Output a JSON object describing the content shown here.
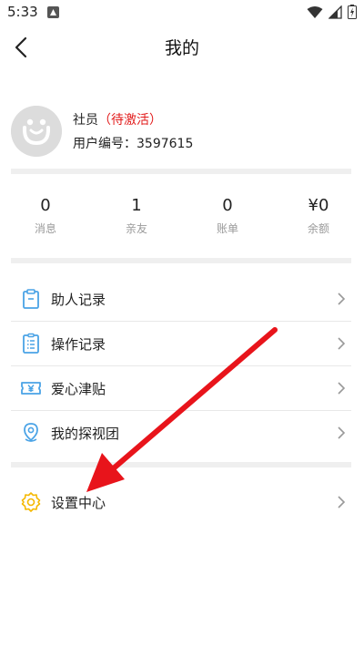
{
  "status_bar": {
    "time": "5:33"
  },
  "header": {
    "title": "我的"
  },
  "profile": {
    "role": "社员",
    "status_open": "（",
    "status": "待激活",
    "status_close": "）",
    "id_label": "用户编号：",
    "id_value": "3597615"
  },
  "stats": [
    {
      "value": "0",
      "label": "消息"
    },
    {
      "value": "1",
      "label": "亲友"
    },
    {
      "value": "0",
      "label": "账单"
    },
    {
      "value": "¥0",
      "label": "余额"
    }
  ],
  "menu": [
    {
      "label": "助人记录",
      "icon": "clipboard-icon"
    },
    {
      "label": "操作记录",
      "icon": "list-document-icon"
    },
    {
      "label": "爱心津贴",
      "icon": "coupon-yen-icon"
    },
    {
      "label": "我的探视团",
      "icon": "location-pin-icon"
    }
  ],
  "settings": {
    "label": "设置中心",
    "icon": "gear-icon"
  },
  "colors": {
    "icon_blue": "#4aa3e6",
    "icon_yellow": "#f5b800",
    "status_red": "#e21b1b",
    "annotation_arrow": "#e8141b"
  }
}
